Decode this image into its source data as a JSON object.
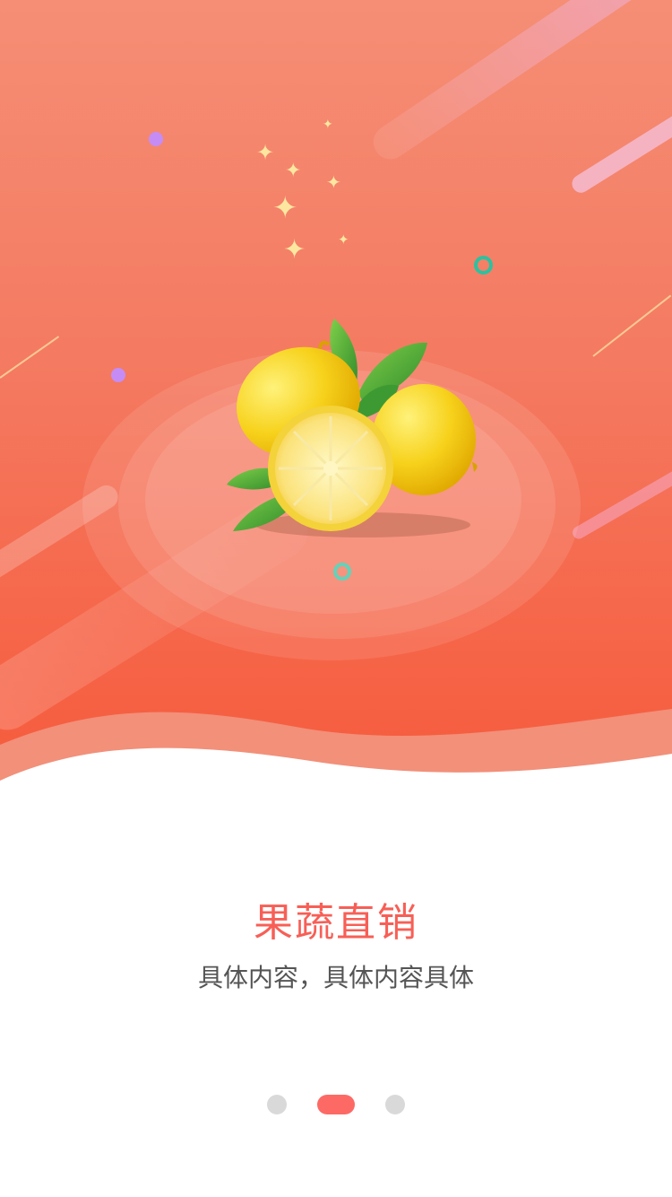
{
  "onboarding": {
    "title": "果蔬直销",
    "subtitle": "具体内容，具体内容具体",
    "illustration": "lemon-fruit-illustration",
    "pager": {
      "total": 3,
      "active_index": 1
    }
  },
  "colors": {
    "hero_top": "#f58e75",
    "hero_bottom": "#f7593a",
    "title": "#f75f56",
    "subtitle": "#555555",
    "pager_active": "#fd6a66",
    "pager_inactive": "#d9d9d9",
    "ring_accent": "#2bc2a0",
    "dot_accent": "#c58cf5",
    "sparkle": "#fde7a0"
  }
}
